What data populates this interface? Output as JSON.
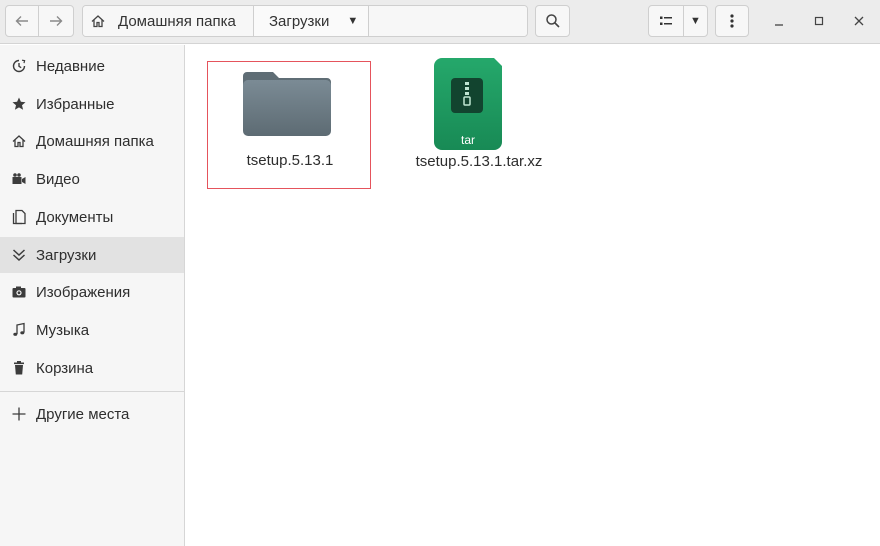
{
  "header": {
    "path": [
      {
        "label": "Домашняя папка",
        "icon": "home-icon"
      },
      {
        "label": "Загрузки",
        "icon": "chevron-down-icon"
      }
    ],
    "buttons": {
      "back": "back-arrow-icon",
      "forward": "forward-arrow-icon",
      "search": "search-icon",
      "view": "list-view-icon",
      "menu": "kebab-menu-icon"
    }
  },
  "sidebar": {
    "items": [
      {
        "label": "Недавние",
        "icon": "clock-icon"
      },
      {
        "label": "Избранные",
        "icon": "star-icon"
      },
      {
        "label": "Домашняя папка",
        "icon": "home-icon"
      },
      {
        "label": "Видео",
        "icon": "video-icon"
      },
      {
        "label": "Документы",
        "icon": "document-icon"
      },
      {
        "label": "Загрузки",
        "icon": "download-icon",
        "active": true
      },
      {
        "label": "Изображения",
        "icon": "camera-icon"
      },
      {
        "label": "Музыка",
        "icon": "music-icon"
      },
      {
        "label": "Корзина",
        "icon": "trash-icon"
      }
    ],
    "other": {
      "label": "Другие места",
      "icon": "plus-icon"
    }
  },
  "files": [
    {
      "name": "tsetup.5.13.1",
      "type": "folder",
      "selected": true
    },
    {
      "name": "tsetup.5.13.1.tar.xz",
      "type": "archive",
      "badge": "tar"
    }
  ],
  "colors": {
    "selection_border": "#e5535c",
    "folder": "#6f7f88",
    "archive": "#1e9b62"
  }
}
